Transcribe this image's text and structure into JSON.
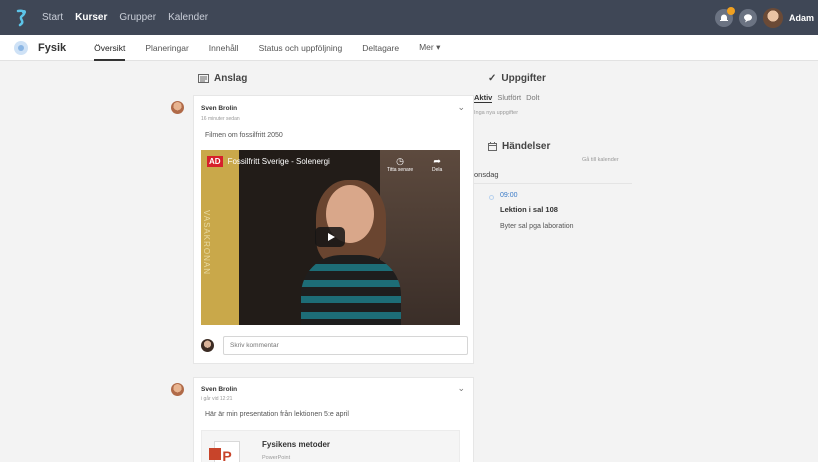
{
  "topnav": {
    "items": [
      {
        "label": "Start",
        "active": false
      },
      {
        "label": "Kurser",
        "active": true
      },
      {
        "label": "Grupper",
        "active": false
      },
      {
        "label": "Kalender",
        "active": false
      }
    ],
    "user_name": "Adam"
  },
  "course": {
    "name": "Fysik",
    "tabs": [
      {
        "label": "Översikt",
        "active": true
      },
      {
        "label": "Planeringar",
        "active": false
      },
      {
        "label": "Innehåll",
        "active": false
      },
      {
        "label": "Status och uppföljning",
        "active": false
      },
      {
        "label": "Deltagare",
        "active": false
      },
      {
        "label": "Mer ▾",
        "active": false
      }
    ]
  },
  "announcements": {
    "heading": "Anslag",
    "posts": [
      {
        "author": "Sven Brolin",
        "time": "16 minuter sedan",
        "text": "Filmen om fossilfritt 2050",
        "video": {
          "channel_logo": "AD",
          "title": "Fossilfritt Sverige - Solenergi",
          "watch_later": "Titta senare",
          "share": "Dela",
          "banner_text": "VASAKRONAN"
        },
        "comment_placeholder": "Skriv kommentar"
      },
      {
        "author": "Sven Brolin",
        "time": "i går vid 12:21",
        "text": "Här är min presentation från lektionen 5:e april",
        "attachment": {
          "icon_letter": "P",
          "title": "Fysikens metoder",
          "subtitle": "PowerPoint"
        }
      }
    ]
  },
  "tasks": {
    "heading": "Uppgifter",
    "filters": [
      {
        "label": "Aktiv",
        "active": true
      },
      {
        "label": "Slutfört",
        "active": false
      },
      {
        "label": "Dolt",
        "active": false
      }
    ],
    "empty_text": "Inga nya uppgifter"
  },
  "events": {
    "heading": "Händelser",
    "calendar_link": "Gå till kalender",
    "day": "onsdag",
    "items": [
      {
        "time": "09:00",
        "title": "Lektion i sal 108",
        "description": "Byter sal pga laboration"
      }
    ]
  },
  "colors": {
    "topbar": "#3f4756",
    "accent_link": "#3a7bc8",
    "notification": "#f0a020"
  }
}
